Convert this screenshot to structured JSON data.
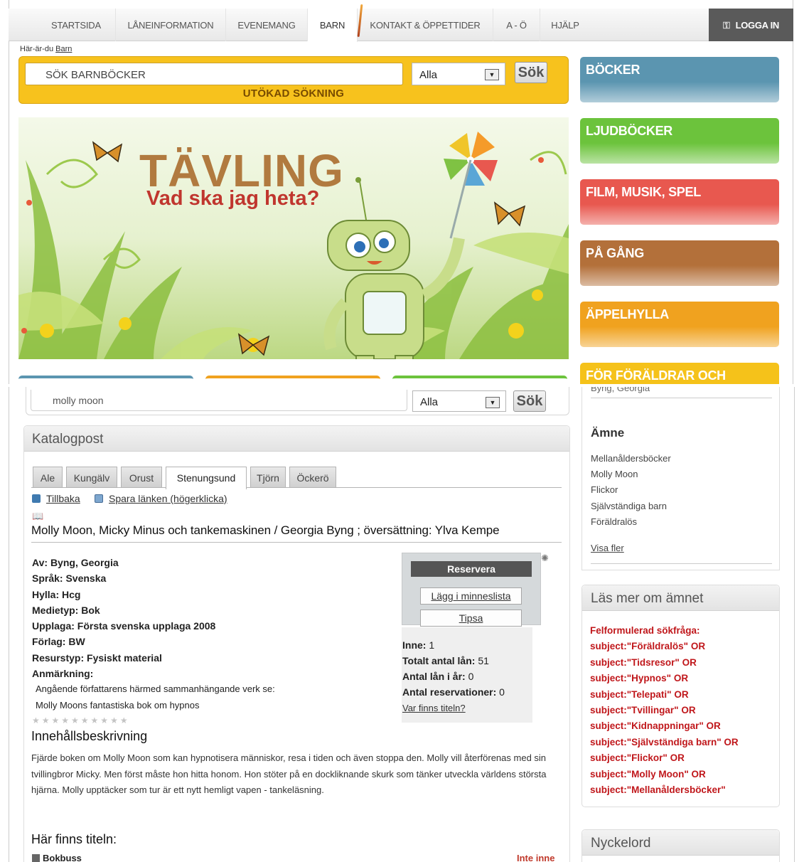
{
  "nav": {
    "items": [
      "STARTSIDA",
      "LÅNEINFORMATION",
      "EVENEMANG",
      "BARN",
      "KONTAKT & ÖPPETTIDER",
      "A - Ö",
      "HJÄLP"
    ],
    "active": "BARN",
    "login": "LOGGA IN"
  },
  "breadcrumb": {
    "prefix": "Här-är-du",
    "link": "Barn"
  },
  "search_top": {
    "placeholder": "SÖK BARNBÖCKER",
    "select": "Alla",
    "button": "Sök",
    "advanced": "UTÖKAD SÖKNING"
  },
  "banner": {
    "title": "TÄVLING",
    "subtitle": "Vad ska jag heta?"
  },
  "categories": [
    {
      "label": "BÖCKER",
      "color": "#5b95b0"
    },
    {
      "label": "LJUDBÖCKER",
      "color": "#6cc33c"
    },
    {
      "label": "FILM, MUSIK, SPEL",
      "color": "#e8584f"
    },
    {
      "label": "PÅ GÅNG",
      "color": "#b3703a"
    },
    {
      "label": "ÄPPELHYLLA",
      "color": "#f0a21f"
    },
    {
      "label": "FÖR FÖRÄLDRAR OCH",
      "color": "#f5c21a"
    }
  ],
  "search_bottom": {
    "value": "molly moon",
    "select": "Alla",
    "button": "Sök"
  },
  "panel": {
    "title": "Katalogpost",
    "tabs": [
      "Ale",
      "Kungälv",
      "Orust",
      "Stenungsund",
      "Tjörn",
      "Öckerö"
    ],
    "active_tab": "Stenungsund",
    "back": "Tillbaka",
    "save_link": "Spara länken (högerklicka)"
  },
  "record": {
    "title": "Molly Moon, Micky Minus och tankemaskinen / Georgia Byng ; översättning: Ylva Kempe",
    "fields": [
      {
        "label": "Av:",
        "value": "Byng, Georgia"
      },
      {
        "label": "Språk:",
        "value": "Svenska"
      },
      {
        "label": "Hylla:",
        "value": "Hcg"
      },
      {
        "label": "Medietyp:",
        "value": "Bok"
      },
      {
        "label": "Upplaga:",
        "value": "Första svenska upplaga 2008"
      },
      {
        "label": "Förlag:",
        "value": "BW"
      },
      {
        "label": "Resurstyp:",
        "value": "Fysiskt material"
      },
      {
        "label": "Anmärkning:",
        "value": ""
      }
    ],
    "note_lines": [
      "Angående författarens härmed sammanhängande verk se:",
      "Molly Moons fantastiska bok om hypnos"
    ],
    "stars": "★★★★★★★★★★",
    "desc_heading": "Innehållsbeskrivning",
    "description": "Fjärde boken om Molly Moon som kan hypnotisera människor, resa i tiden och även stoppa den. Molly vill återförenas med sin tvillingbror Micky. Men först måste hon hitta honom. Hon stöter på en dockliknande skurk som tänker utveckla världens största hjärna. Molly upptäcker som tur är ett nytt hemligt vapen - tankeläsning.",
    "where_heading": "Här finns titeln:",
    "location": "Bokbuss",
    "location_status": "Inte inne"
  },
  "actions": {
    "reserve": "Reservera",
    "wishlist": "Lägg i minneslista",
    "tip": "Tipsa"
  },
  "stats": {
    "inne_label": "Inne:",
    "inne": "1",
    "total_label": "Totalt antal lån:",
    "total": "51",
    "year_label": "Antal lån i år:",
    "year": "0",
    "res_label": "Antal reservationer:",
    "res": "0",
    "where_link": "Var finns titeln?"
  },
  "side": {
    "cut_text": "Byng, Georgia",
    "amne_heading": "Ämne",
    "amne_items": [
      "Mellanåldersböcker",
      "Molly Moon",
      "Flickor",
      "Självständiga barn",
      "Föräldralös"
    ],
    "more": "Visa fler",
    "las_heading": "Läs mer om ämnet",
    "las_lines": [
      "Felformulerad sökfråga:",
      "subject:\"Föräldralös\" OR",
      "subject:\"Tidsresor\" OR",
      "subject:\"Hypnos\" OR",
      "subject:\"Telepati\" OR",
      "subject:\"Tvillingar\" OR",
      "subject:\"Kidnappningar\" OR",
      "subject:\"Självständiga barn\" OR",
      "subject:\"Flickor\" OR",
      "subject:\"Molly Moon\" OR",
      "subject:\"Mellanåldersböcker\""
    ],
    "nyckel_heading": "Nyckelord"
  }
}
